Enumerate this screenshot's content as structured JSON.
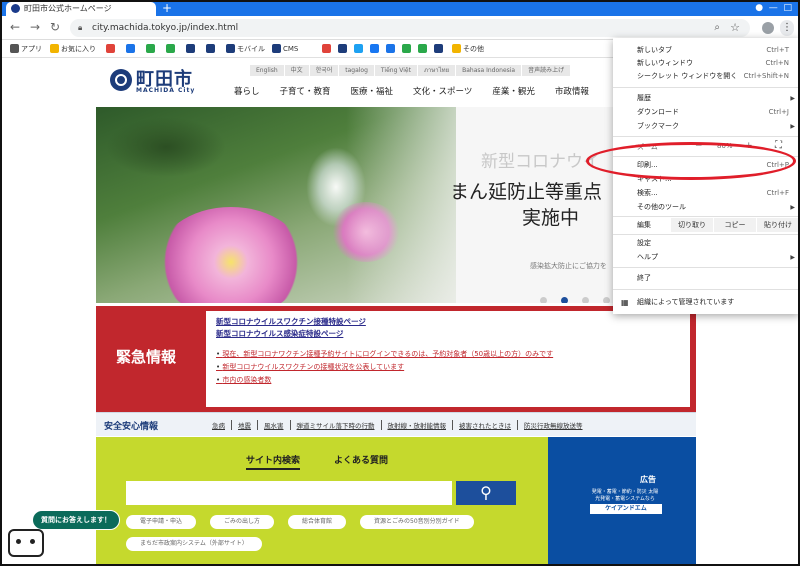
{
  "browser": {
    "tab_title": "町田市公式ホームページ",
    "url": "city.machida.tokyo.jp/index.html",
    "bookmarks": [
      {
        "label": "アプリ",
        "color": "#555555"
      },
      {
        "label": "お気に入り",
        "color": "#f2b400"
      },
      {
        "label": "",
        "color": "#e0433a"
      },
      {
        "label": "",
        "color": "#1a73e8"
      },
      {
        "label": "",
        "color": "#2aa84a"
      },
      {
        "label": "",
        "color": "#2aa84a"
      },
      {
        "label": "",
        "color": "#1d3c7a"
      },
      {
        "label": "",
        "color": "#1d3c7a"
      },
      {
        "label": "モバイル",
        "color": "#1d3c7a"
      },
      {
        "label": "CMS",
        "color": "#1d3c7a"
      },
      {
        "label": "",
        "color": "#e0433a"
      },
      {
        "label": "",
        "color": "#1d3c7a"
      },
      {
        "label": "",
        "color": "#1da1f2"
      },
      {
        "label": "",
        "color": "#1877f2"
      },
      {
        "label": "",
        "color": "#1a73e8"
      },
      {
        "label": "",
        "color": "#2aa84a"
      },
      {
        "label": "",
        "color": "#2aa84a"
      },
      {
        "label": "",
        "color": "#1d3c7a"
      },
      {
        "label": "その他",
        "color": "#f2b400"
      }
    ]
  },
  "site": {
    "logo_ja": "町田市",
    "logo_en": "MACHIDA City",
    "languages": [
      "English",
      "中文",
      "한국어",
      "tagalog",
      "Tiếng Việt",
      "ภาษาไทย",
      "Bahasa Indonesia",
      "音声読み上げ"
    ],
    "global_nav": [
      "暮らし",
      "子育て・教育",
      "医療・福祉",
      "文化・スポーツ",
      "産業・観光",
      "市政情報"
    ]
  },
  "hero": {
    "ghost_text": "新型コロナウイ",
    "line1": "まん延防止等重点",
    "line2": "実施中",
    "small_text": "感染拡大防止にご協力を"
  },
  "emergency": {
    "title": "緊急情報",
    "top_links": [
      "新型コロナウイルスワクチン接種特設ページ",
      "新型コロナウイルス感染症特設ページ"
    ],
    "items": [
      "現在、新型コロナワクチン接種予約サイトにログインできるのは、予約対象者（50歳以上の方）のみです",
      "新型コロナウイルスワクチンの接種状況を公表しています",
      "市内の感染者数"
    ]
  },
  "safety": {
    "title": "安全安心情報",
    "links": [
      "急病",
      "地震",
      "風水害",
      "弾道ミサイル落下時の行動",
      "放射線・放射能情報",
      "被害されたときは",
      "防災行政無線放送等"
    ]
  },
  "search": {
    "tab_search": "サイト内検索",
    "tab_faq": "よくある質問",
    "placeholder": "",
    "pills": [
      "電子申請・申込",
      "ごみの出し方",
      "総合体育館",
      "資源とごみの50音別分別ガイド",
      "まちだ市政案内システム（外部サイト）"
    ]
  },
  "ad": {
    "label": "広告",
    "text": "発電・蓄電・節約・防災 太陽光発電・蓄電システムなら",
    "brand": "ケイアンドエム"
  },
  "chat": {
    "bubble": "質問にお答えします！"
  },
  "menu": {
    "items": [
      {
        "label": "新しいタブ",
        "shortcut": "Ctrl+T"
      },
      {
        "label": "新しいウィンドウ",
        "shortcut": "Ctrl+N"
      },
      {
        "label": "シークレット ウィンドウを開く",
        "shortcut": "Ctrl+Shift+N"
      },
      {
        "label": "履歴",
        "shortcut": ""
      },
      {
        "label": "ダウンロード",
        "shortcut": "Ctrl+J"
      },
      {
        "label": "ブックマーク",
        "shortcut": ""
      },
      {
        "label": "印刷...",
        "shortcut": "Ctrl+P"
      },
      {
        "label": "キャスト...",
        "shortcut": ""
      },
      {
        "label": "検索...",
        "shortcut": "Ctrl+F"
      },
      {
        "label": "その他のツール",
        "shortcut": ""
      },
      {
        "label": "設定",
        "shortcut": ""
      },
      {
        "label": "ヘルプ",
        "shortcut": ""
      },
      {
        "label": "終了",
        "shortcut": ""
      },
      {
        "label": "組織によって管理されています",
        "shortcut": ""
      }
    ],
    "zoom_label": "ズーム",
    "zoom_value": "80%",
    "edit_label": "編集",
    "cut": "切り取り",
    "copy": "コピー",
    "paste": "貼り付け"
  },
  "annotation": {
    "ellipse_color": "#e01e2a"
  }
}
